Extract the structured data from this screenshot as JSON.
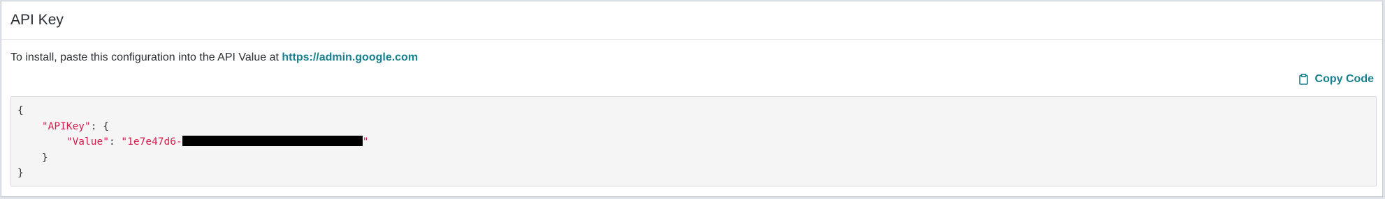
{
  "panel": {
    "title": "API Key"
  },
  "instructions": {
    "text": "To install, paste this configuration into the API Value at ",
    "link": "https://admin.google.com"
  },
  "copy_button": {
    "label": "Copy Code",
    "icon": "clipboard-icon"
  },
  "code": {
    "open_brace": "{",
    "key_apikey": "\"APIKey\"",
    "colon_brace": ": {",
    "key_value": "\"Value\"",
    "colon": ": ",
    "value_prefix": "\"1e7e47d6-",
    "value_suffix": "\"",
    "inner_close": "}",
    "close_brace": "}"
  },
  "colors": {
    "link": "#1a7f8e",
    "string": "#d6204f",
    "code_bg": "#f5f5f5"
  }
}
